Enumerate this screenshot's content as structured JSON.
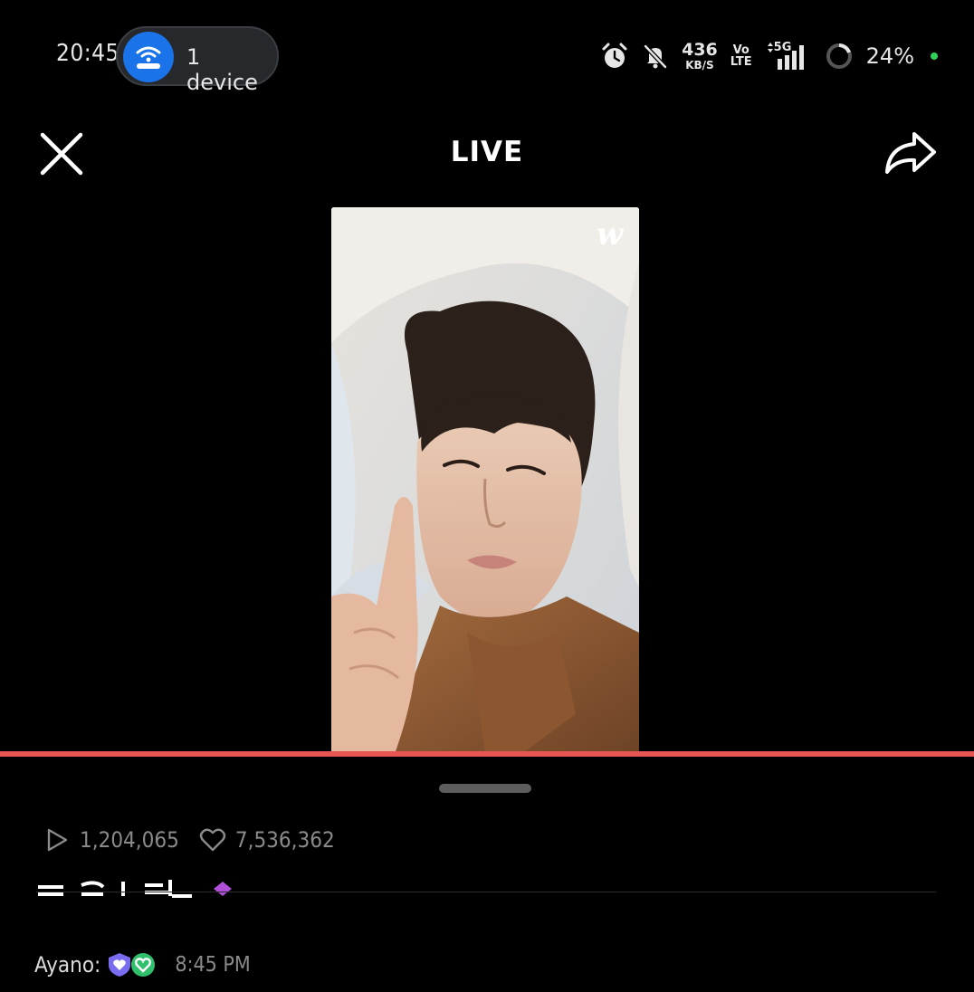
{
  "status_bar": {
    "time": "20:45",
    "hotspot_label": "1 device",
    "net_speed_value": "436",
    "net_speed_unit": "KB/S",
    "volte_top": "Vo",
    "volte_bottom": "LTE",
    "network_type": "5G",
    "battery_percent": "24%",
    "icons": [
      "alarm-icon",
      "bell-muted-icon",
      "signal-icon",
      "battery-ring-icon"
    ]
  },
  "header": {
    "title": "LIVE",
    "close_icon": "close-icon",
    "share_icon": "share-icon"
  },
  "video": {
    "brand_mark": "w",
    "progress": 1.0,
    "progress_color": "#e85555"
  },
  "stats": {
    "plays": "1,204,065",
    "likes": "7,536,362"
  },
  "comment": {
    "user": "Ayano:",
    "time": "8:45 PM"
  }
}
